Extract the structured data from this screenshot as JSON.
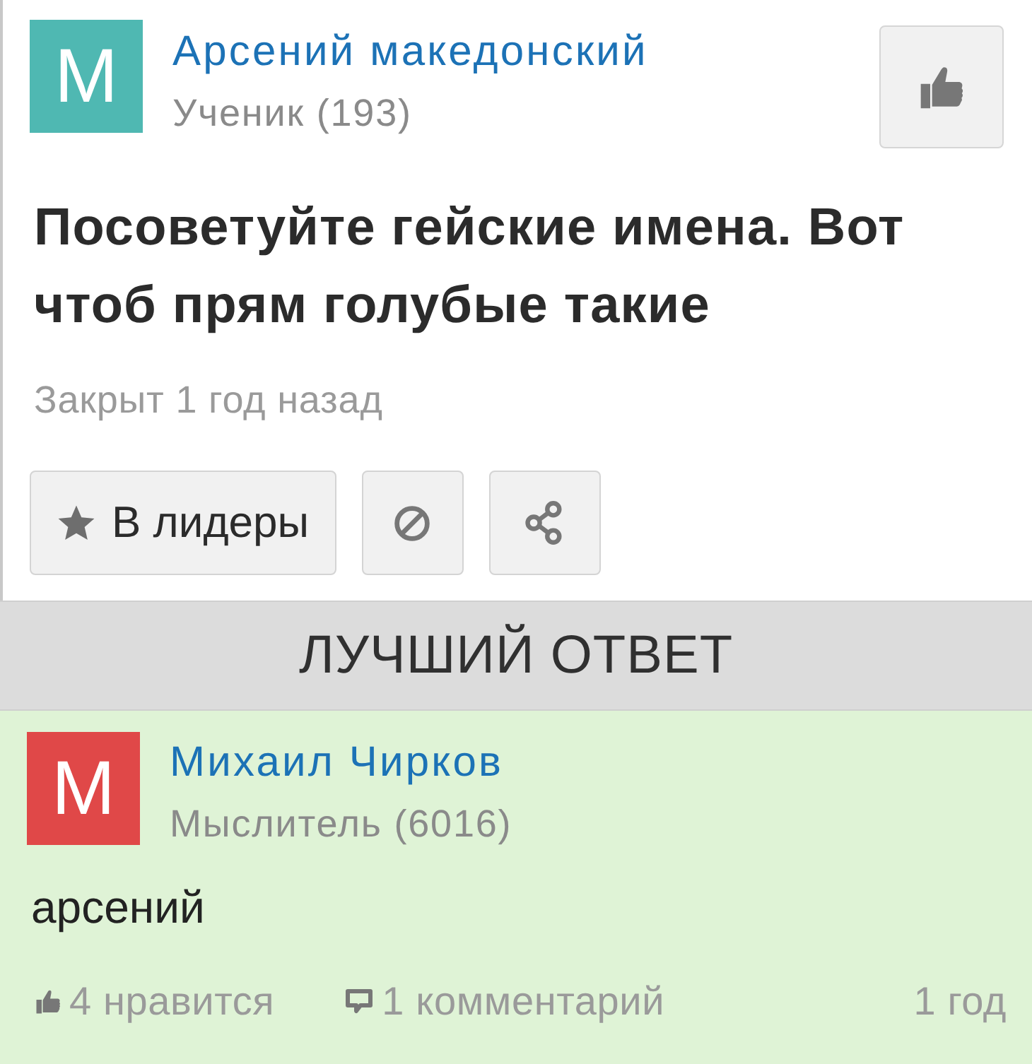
{
  "question": {
    "author": {
      "avatar": "M",
      "name": "Арсений македонский",
      "rank": "Ученик (193)"
    },
    "title": "Посоветуйте гейские имена. Вот чтоб прям голубые такие",
    "status": "Закрыт 1 год назад",
    "actions": [
      {
        "kind": "leaders",
        "label": "В лидеры"
      },
      {
        "kind": "block"
      },
      {
        "kind": "share"
      }
    ]
  },
  "best_answer": {
    "heading": "ЛУЧШИЙ ОТВЕТ",
    "author": {
      "avatar": "M",
      "name": "Михаил Чирков",
      "rank": "Мыслитель (6016)"
    },
    "text": "арсений",
    "likes": "4 нравится",
    "comments": "1 комментарий",
    "time": "1 год"
  }
}
